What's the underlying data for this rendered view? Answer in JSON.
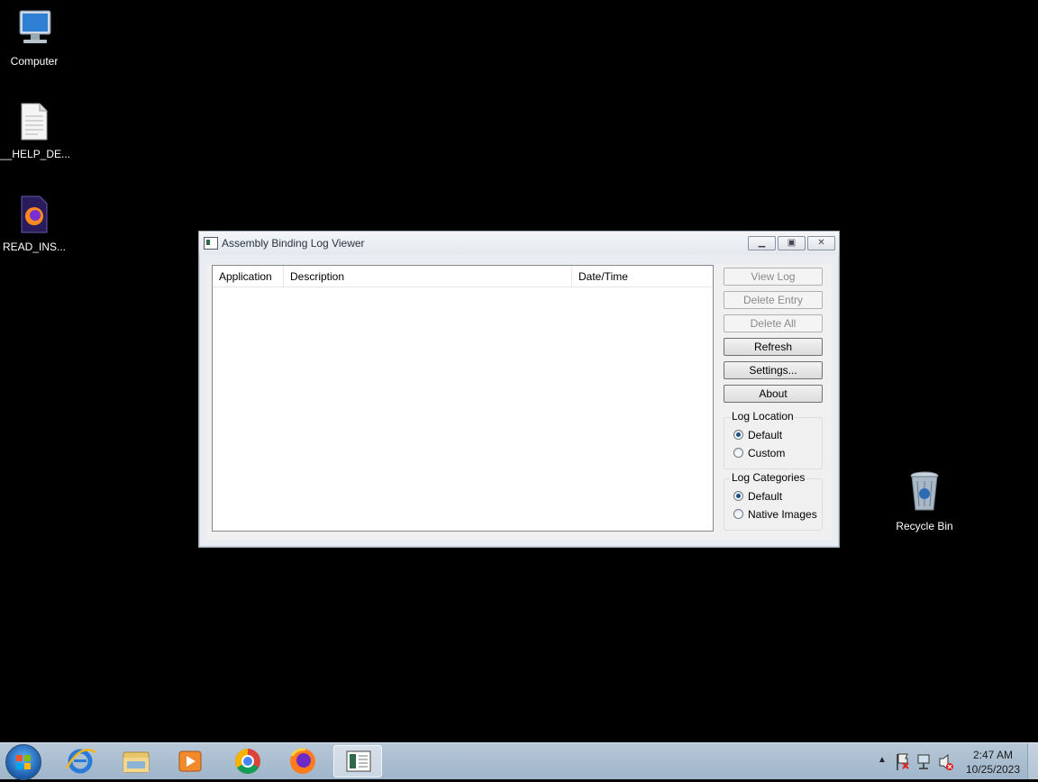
{
  "desktop": {
    "icons": [
      {
        "label": "Computer"
      },
      {
        "label": "__HELP_DE..."
      },
      {
        "label": "READ_INS..."
      },
      {
        "label": "Recycle Bin"
      }
    ]
  },
  "window": {
    "title": "Assembly Binding Log Viewer",
    "columns": [
      "Application",
      "Description",
      "Date/Time"
    ],
    "rows": [],
    "buttons": {
      "view_log": "View Log",
      "delete_entry": "Delete Entry",
      "delete_all": "Delete All",
      "refresh": "Refresh",
      "settings": "Settings...",
      "about": "About"
    },
    "log_location": {
      "title": "Log Location",
      "options": [
        "Default",
        "Custom"
      ],
      "selected": "Default"
    },
    "log_categories": {
      "title": "Log Categories",
      "options": [
        "Default",
        "Native Images"
      ],
      "selected": "Default"
    }
  },
  "taskbar": {
    "items": [
      "start-button",
      "internet-explorer",
      "windows-explorer",
      "media-player",
      "chrome",
      "firefox",
      "fuslogvw"
    ],
    "active_item": "fuslogvw",
    "clock": {
      "time": "2:47 AM",
      "date": "10/25/2023"
    }
  }
}
